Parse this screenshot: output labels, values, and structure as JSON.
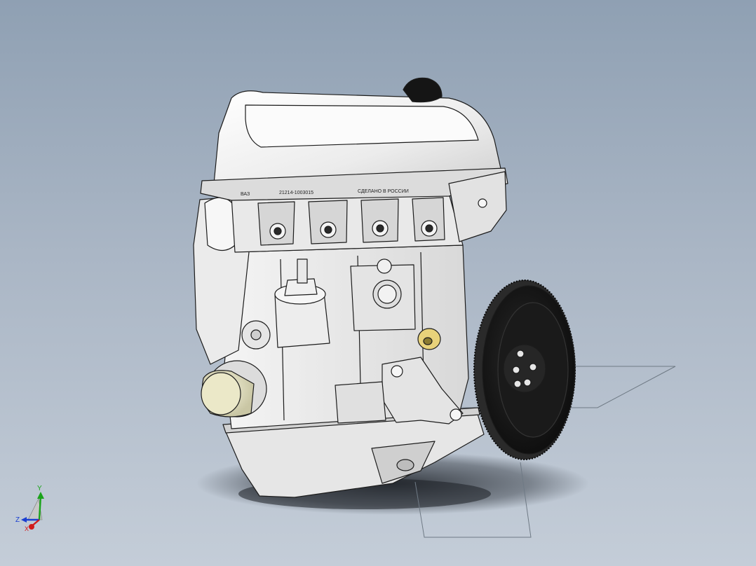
{
  "viewport": {
    "background_top": "#8fa0b3",
    "background_bottom": "#c4cdd8"
  },
  "model": {
    "head_stamp_part_number": "21214-1003015",
    "head_stamp_origin": "СДЕЛАНО В РОССИИ",
    "head_stamp_short": "ВАЗ",
    "shell_color": "#f2f2f2",
    "flywheel_color": "#1a1a1a",
    "oil_filter_color": "#e9e6c8",
    "oil_plug_color": "#e8d27a"
  },
  "triad": {
    "x_label": "X",
    "y_label": "Y",
    "z_label": "Z",
    "x_color": "#d11a1a",
    "y_color": "#1aa31a",
    "z_color": "#1a3fd1"
  }
}
